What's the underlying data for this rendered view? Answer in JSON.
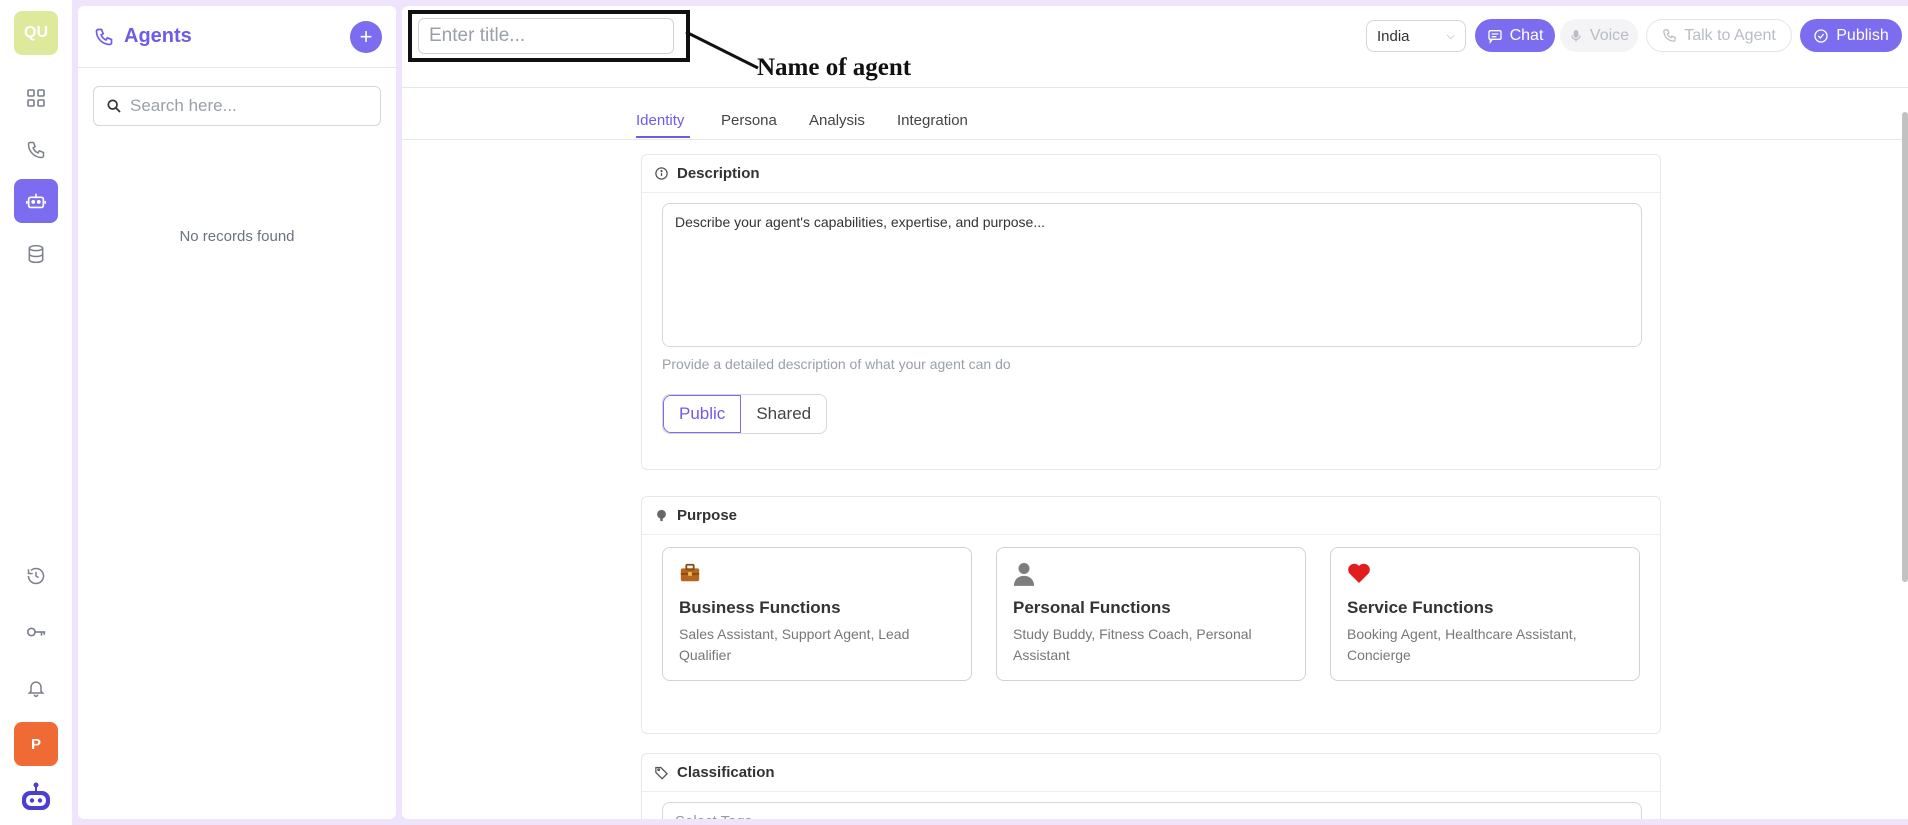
{
  "rail": {
    "workspace_initials": "QU",
    "profile_initial": "P"
  },
  "agents_panel": {
    "title": "Agents",
    "add_label": "+",
    "search_placeholder": "Search here...",
    "empty_text": "No records found"
  },
  "header": {
    "title_placeholder": "Enter title...",
    "annotation": "Name of agent",
    "country": "India",
    "chat_label": "Chat",
    "voice_label": "Voice",
    "talk_label": "Talk to Agent",
    "publish_label": "Publish"
  },
  "tabs": [
    {
      "label": "Identity",
      "active": true
    },
    {
      "label": "Persona",
      "active": false
    },
    {
      "label": "Analysis",
      "active": false
    },
    {
      "label": "Integration",
      "active": false
    }
  ],
  "description": {
    "heading": "Description",
    "placeholder": "Describe your agent's capabilities, expertise, and purpose...",
    "hint": "Provide a detailed description of what your agent can do",
    "visibility_options": [
      "Public",
      "Shared"
    ],
    "selected_visibility": "Public"
  },
  "purpose": {
    "heading": "Purpose",
    "cards": [
      {
        "icon": "briefcase-icon",
        "title": "Business Functions",
        "subtitle": "Sales Assistant, Support Agent, Lead Qualifier"
      },
      {
        "icon": "person-icon",
        "title": "Personal Functions",
        "subtitle": "Study Buddy, Fitness Coach, Personal Assistant"
      },
      {
        "icon": "heart-icon",
        "title": "Service Functions",
        "subtitle": "Booking Agent, Healthcare Assistant, Concierge"
      }
    ]
  },
  "classification": {
    "heading": "Classification",
    "tags_placeholder": "Select Tags"
  },
  "colors": {
    "accent": "#7b6cf0",
    "accent_text": "#6d5ce7",
    "frame": "#efe4fb",
    "profile_badge": "#ef6a35",
    "workspace_badge": "#dfe99b",
    "heart": "#e11d1d",
    "briefcase": "#b5651d"
  }
}
